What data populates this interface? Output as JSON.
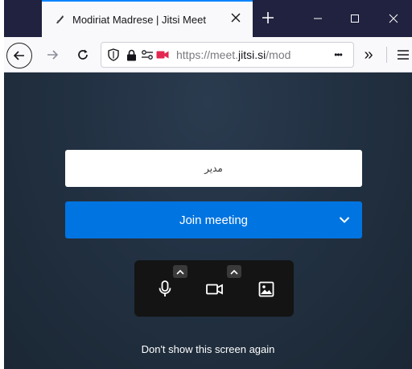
{
  "browser": {
    "tab_title": "Modiriat Madrese | Jitsi Meet",
    "url_host_prefix": "https://meet.",
    "url_host": "jitsi.si",
    "url_path": "/mod",
    "page_actions_label": "•••",
    "overflow_label": "»"
  },
  "prejoin": {
    "name_value": "مدیر",
    "join_label": "Join meeting",
    "dont_show_label": "Don't show this screen again"
  },
  "colors": {
    "accent": "#0074e0",
    "tab_strip": "#20223f",
    "background": "#1f2b38"
  }
}
